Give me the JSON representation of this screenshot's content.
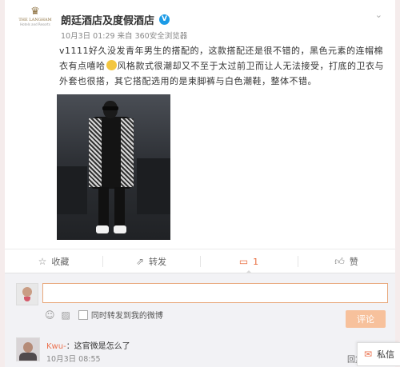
{
  "post": {
    "author": "朗廷酒店及度假酒店",
    "verified_mark": "V",
    "meta": "10月3日 01:29 来自 360安全浏览器",
    "logo": {
      "crest": "♛",
      "brand": "THE LANGHAM",
      "sub": "Hotels and Resorts"
    },
    "text_before_emoji": "v1111好久没发青年男生的搭配的，这款搭配还是很不错的，黑色元素的连帽棉衣有点嘻哈",
    "text_after_emoji": "风格款式很潮却又不至于太过前卫而让人无法接受，打底的卫衣与外套也很搭，其它搭配选用的是束脚裤与白色潮鞋，整体不错。"
  },
  "actions": {
    "favorite": "收藏",
    "repost": "转发",
    "comment_count": "1",
    "like": "赞"
  },
  "comment_box": {
    "value": "",
    "sync_label": "同时转发到我的微博",
    "submit": "评论"
  },
  "reply": {
    "user": "Kwu-",
    "text": "：这官微是怎么了",
    "time": "10月3日 08:55",
    "action": "回复"
  },
  "chat": {
    "label": "私信"
  },
  "colors": {
    "accent": "#eb7350",
    "verified": "#1c9be6",
    "submit_bg": "#f7c19c"
  }
}
